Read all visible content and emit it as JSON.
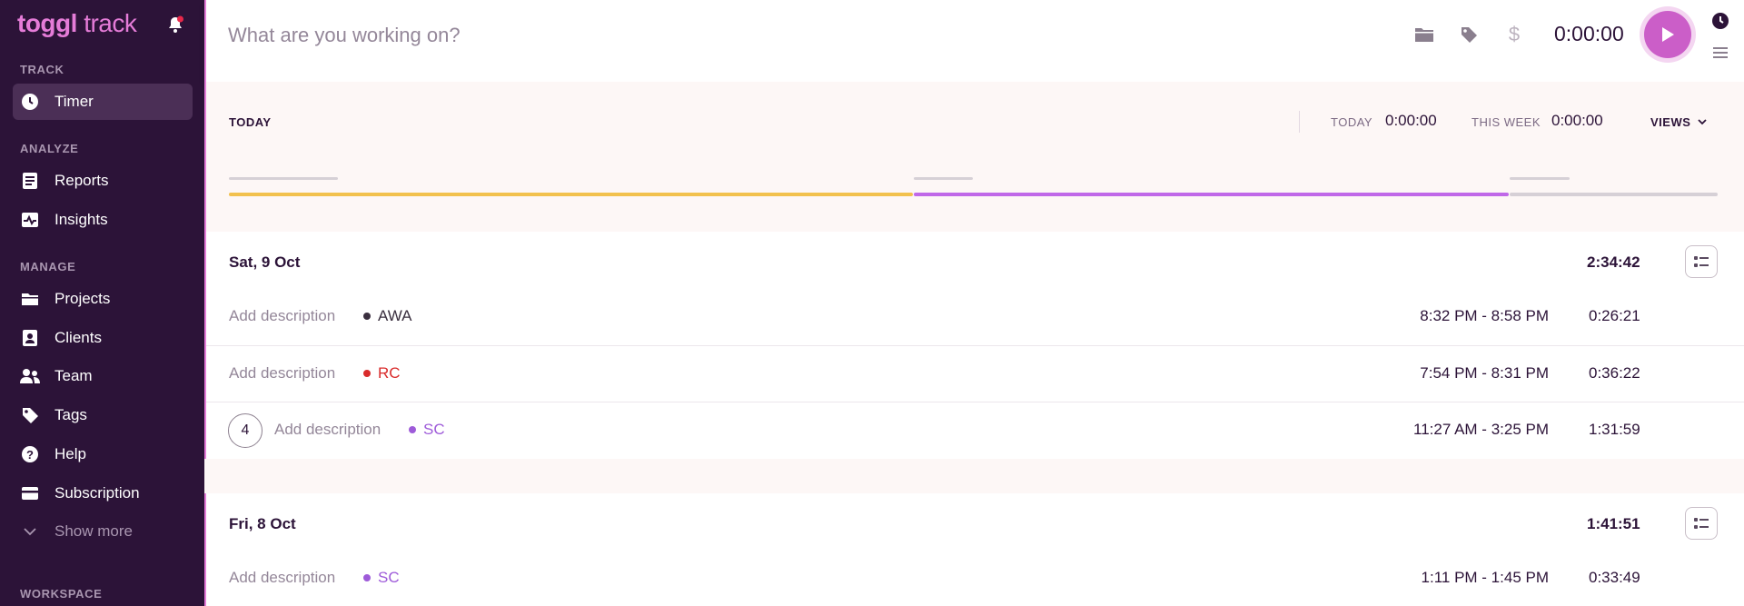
{
  "brand": {
    "logo_bold": "toggl",
    "logo_light": " track"
  },
  "sidebar": {
    "sections": [
      {
        "label": "TRACK"
      },
      {
        "label": "ANALYZE"
      },
      {
        "label": "MANAGE"
      },
      {
        "label": "WORKSPACE"
      }
    ],
    "items": [
      {
        "label": "Timer",
        "icon": "clock-icon"
      },
      {
        "label": "Reports",
        "icon": "reports-icon"
      },
      {
        "label": "Insights",
        "icon": "insights-icon"
      },
      {
        "label": "Projects",
        "icon": "folder-icon"
      },
      {
        "label": "Clients",
        "icon": "clients-icon"
      },
      {
        "label": "Team",
        "icon": "team-icon"
      },
      {
        "label": "Tags",
        "icon": "tag-icon"
      },
      {
        "label": "Help",
        "icon": "help-icon"
      },
      {
        "label": "Subscription",
        "icon": "card-icon"
      },
      {
        "label": "Show more",
        "icon": "chevron-down-icon"
      }
    ]
  },
  "topbar": {
    "placeholder": "What are you working on?",
    "timer": "0:00:00",
    "billable_symbol": "$"
  },
  "summary": {
    "title": "TODAY",
    "today_label": "TODAY",
    "today_value": "0:00:00",
    "week_label": "THIS WEEK",
    "week_value": "0:00:00",
    "views_label": "VIEWS"
  },
  "days": [
    {
      "date": "Sat, 9 Oct",
      "total": "2:34:42",
      "entries": [
        {
          "description": "Add description",
          "project": "AWA",
          "project_color": "#3a2f3f",
          "range": "8:32 PM - 8:58 PM",
          "duration": "0:26:21",
          "count": ""
        },
        {
          "description": "Add description",
          "project": "RC",
          "project_color": "#d92b2b",
          "range": "7:54 PM - 8:31 PM",
          "duration": "0:36:22",
          "count": ""
        },
        {
          "description": "Add description",
          "project": "SC",
          "project_color": "#9e5bd9",
          "range": "11:27 AM - 3:25 PM",
          "duration": "1:31:59",
          "count": "4"
        }
      ]
    },
    {
      "date": "Fri, 8 Oct",
      "total": "1:41:51",
      "entries": [
        {
          "description": "Add description",
          "project": "SC",
          "project_color": "#9e5bd9",
          "range": "1:11 PM - 1:45 PM",
          "duration": "0:33:49",
          "count": ""
        }
      ]
    }
  ],
  "colors": {
    "sidebar_bg": "#2c1338",
    "accent": "#e57cd8",
    "play": "#cb5ec8",
    "bar_yellow": "#f2c14e",
    "bar_purple": "#c068e8",
    "bar_gray": "#d6d0d6"
  }
}
